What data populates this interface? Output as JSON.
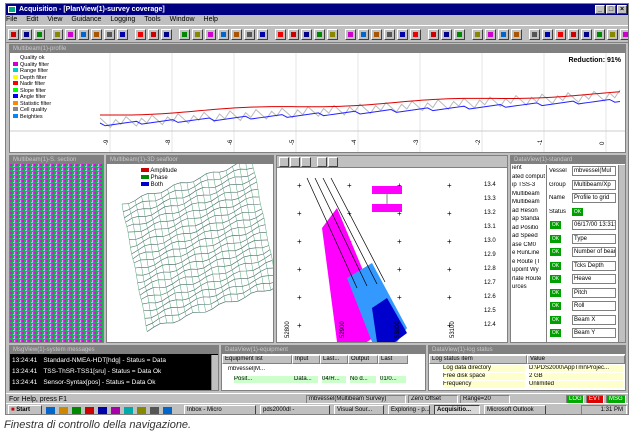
{
  "app": {
    "title": "Acquisition - [PlanView(1)-survey coverage]"
  },
  "menu": [
    "File",
    "Edit",
    "View",
    "Guidance",
    "Logging",
    "Tools",
    "Window",
    "Help"
  ],
  "profile_window": {
    "title": "Multibeam(1)-profile",
    "reduction_label": "Reduction: 91%",
    "legend": [
      "Quality ok",
      "Quality filter",
      "Range filter",
      "Depth filter",
      "Nadir filter",
      "Slope filter",
      "Angle filter",
      "Statistic filter",
      "Cell quality",
      "Beighties"
    ],
    "ticks": [
      "-9",
      "-8",
      "-6",
      "-5",
      "-4",
      "-3",
      "-2",
      "-1",
      "0"
    ]
  },
  "sidescan_window": {
    "title": "Multibeam(1)-S. section"
  },
  "view3d_window": {
    "title": "Multibeam(1)-3D seafloor",
    "legend": [
      "Amplitude",
      "Phase",
      "Both"
    ]
  },
  "plan_window": {
    "y_ticks": [
      "12.4",
      "12.5",
      "12.6",
      "12.7",
      "12.8",
      "12.9",
      "13.0",
      "13.1",
      "13.2",
      "13.3",
      "13.4"
    ],
    "x_ticks": [
      "52800",
      "52900",
      "53000",
      "53100"
    ]
  },
  "data_window": {
    "title": "DataView(1)-standard",
    "left_col": [
      "ient",
      "ated comput",
      "ip TSS-3",
      "Multibeam",
      "Multibeam",
      "ad Reson",
      "ap Standa",
      "ad Positio",
      "ad Speed",
      "ase CM0",
      "e RunLine",
      "e Route (T",
      "upoint Wy",
      "rlate Route",
      "urces"
    ],
    "rows": [
      {
        "label": "Vessel",
        "value": "mbvessel(Mul"
      },
      {
        "label": "Group",
        "value": "Multibeam/Xp"
      },
      {
        "label": "Name",
        "value": "Profile to grid"
      },
      {
        "label": "Status",
        "value": "OK"
      },
      {
        "label": "",
        "value": "06/17/00 13:31:2"
      },
      {
        "label": "",
        "value": "Type"
      },
      {
        "label": "",
        "value": "Number of beams"
      },
      {
        "label": "",
        "value": "Tcks Depth"
      },
      {
        "label": "",
        "value": "Heave"
      },
      {
        "label": "",
        "value": "Pitch"
      },
      {
        "label": "",
        "value": "Roll"
      },
      {
        "label": "",
        "value": "Beam X"
      },
      {
        "label": "",
        "value": "Beam Y"
      }
    ]
  },
  "messages_window": {
    "title": "MsgView(1)-system messages",
    "rows": [
      {
        "time": "13:24:41",
        "text": "Standard-NMEA-HDT[hdg] - Status = Data"
      },
      {
        "time": "13:24:41",
        "text": "TSS-ThSR-TSS1[sru] - Status = Data Ok"
      },
      {
        "time": "13:24:41",
        "text": "Sensor-Syntax[pos] - Status = Data Ok"
      }
    ]
  },
  "equipment_window": {
    "title": "DataView(1)-equipment",
    "headers": [
      "Equipment list",
      "Input",
      "Last...",
      "Output",
      "Last"
    ],
    "rows": [
      [
        "mbvessel[M...",
        "",
        "",
        "",
        ""
      ],
      [
        "Posit...",
        "Data...",
        "04/R...",
        "No d...",
        "01/0..."
      ]
    ]
  },
  "log_window": {
    "title": "DataView(1)-log status",
    "headers": [
      "Log status item",
      "Value"
    ],
    "rows": [
      [
        "Log data directory",
        "D:\\PDS2000\\AppTmr\\Projec..."
      ],
      [
        "Free disk space",
        "2 GB"
      ],
      [
        "Frequency",
        "Unlimited"
      ]
    ]
  },
  "status_bar": {
    "help": "For Help, press F1",
    "vessel": "mbvessel(Multibeam Survey)",
    "offset": "Zero Offset",
    "range": "Range=20",
    "flags": [
      "LOG",
      "EVT",
      "MSG"
    ]
  },
  "taskbar": {
    "start": "Start",
    "tasks": [
      "Inbox - Micro",
      "pds2000dl -",
      "Visual Sour...",
      "Exploring - p...",
      "Acquisitio...",
      "Microsoft Outlook"
    ],
    "clock": "1:31 PM"
  },
  "caption": "Finestra di controllo della navigazione."
}
